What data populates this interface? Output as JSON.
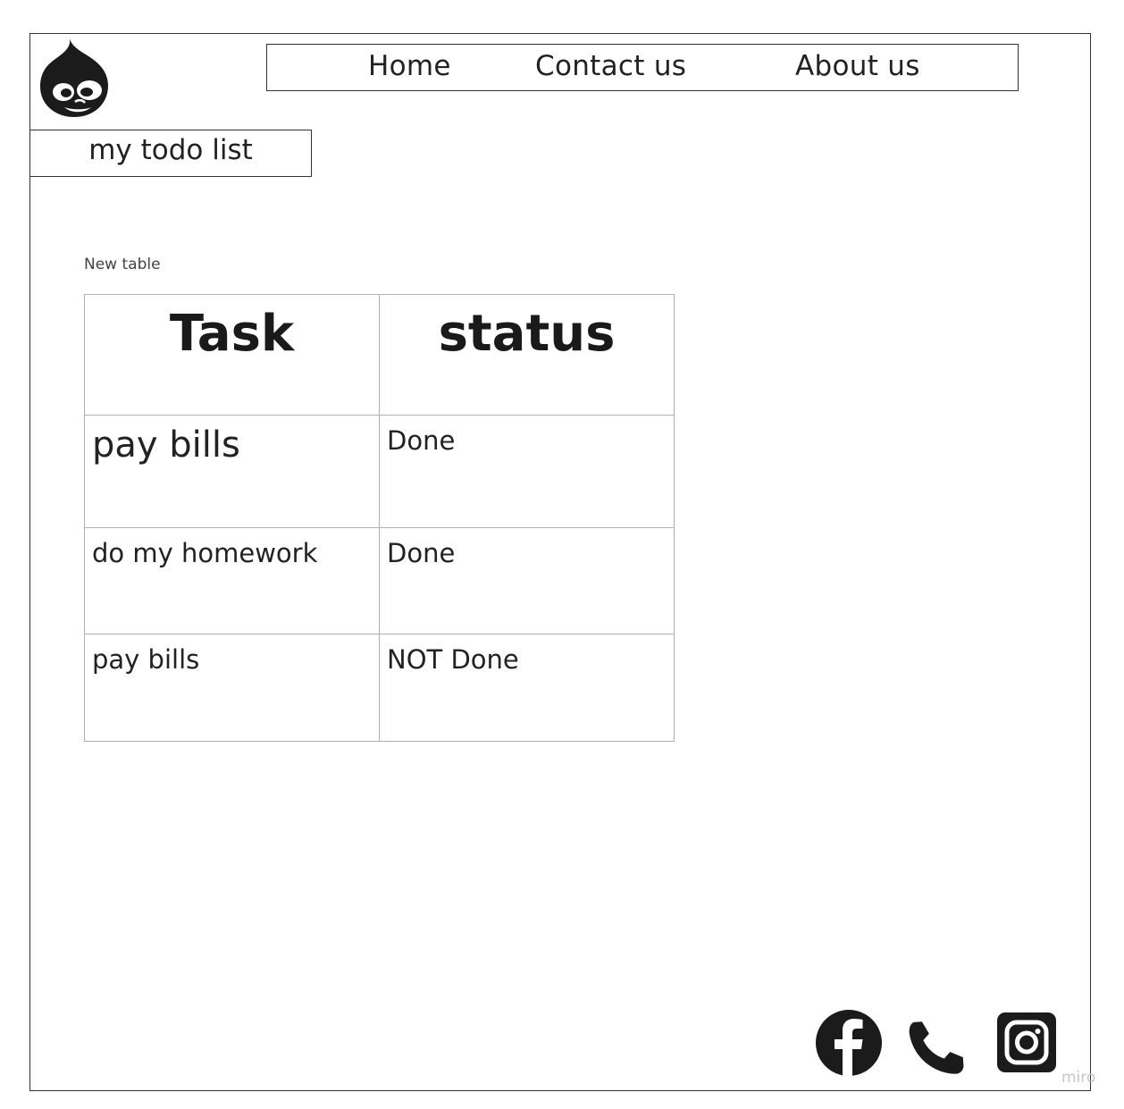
{
  "nav": {
    "home": "Home",
    "contact": "Contact us",
    "about": "About us"
  },
  "page_title": "my todo list",
  "table": {
    "caption": "New table",
    "headers": [
      "Task",
      "status"
    ],
    "rows": [
      {
        "task": "pay bills",
        "status": "Done"
      },
      {
        "task": "do my homework",
        "status": "Done"
      },
      {
        "task": "pay bills",
        "status": "NOT Done"
      }
    ]
  },
  "icons": {
    "logo": "drupal-drop-logo",
    "facebook": "facebook-icon",
    "phone": "phone-icon",
    "instagram": "instagram-icon"
  },
  "watermark": "miro"
}
